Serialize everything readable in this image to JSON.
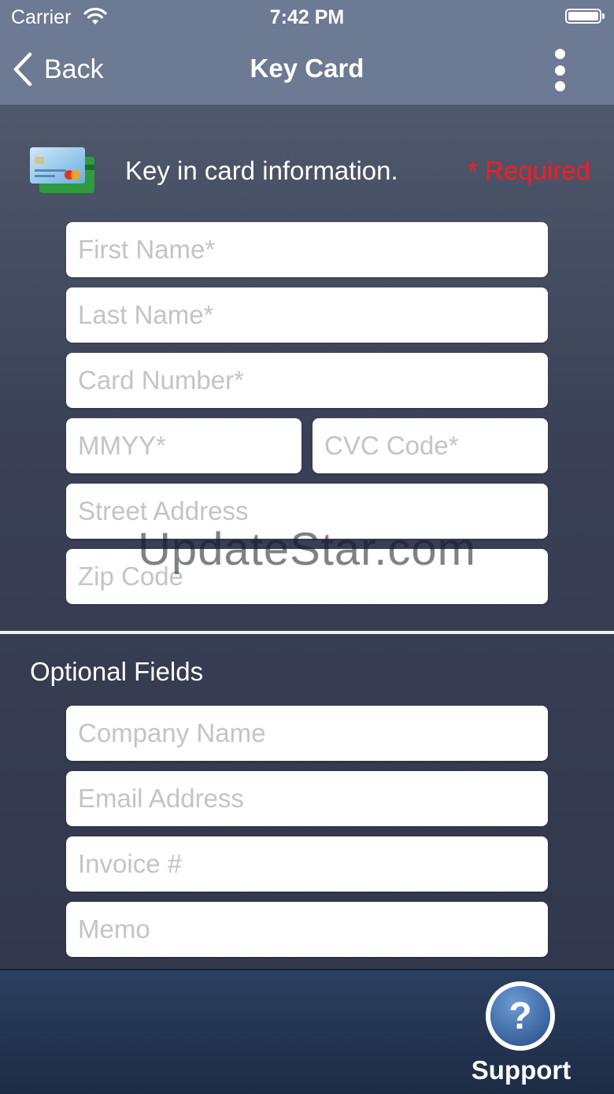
{
  "status_bar": {
    "carrier": "Carrier",
    "time": "7:42 PM"
  },
  "nav": {
    "back_label": "Back",
    "title": "Key Card"
  },
  "header": {
    "text": "Key in card information.",
    "required": "* Required"
  },
  "fields": {
    "first_name": "First Name*",
    "last_name": "Last Name*",
    "card_number": "Card Number*",
    "expiry": "MMYY*",
    "cvc": "CVC Code*",
    "street": "Street Address",
    "zip": "Zip Code"
  },
  "optional": {
    "title": "Optional Fields",
    "company": "Company Name",
    "email": "Email Address",
    "invoice": "Invoice #",
    "memo": "Memo"
  },
  "watermark": "UpdateStar.com",
  "bottom": {
    "support_label": "Support"
  },
  "colors": {
    "required_red": "#ff1a1a",
    "nav_bg": "#6c7a93",
    "support_blue": "#3d6aa6"
  }
}
